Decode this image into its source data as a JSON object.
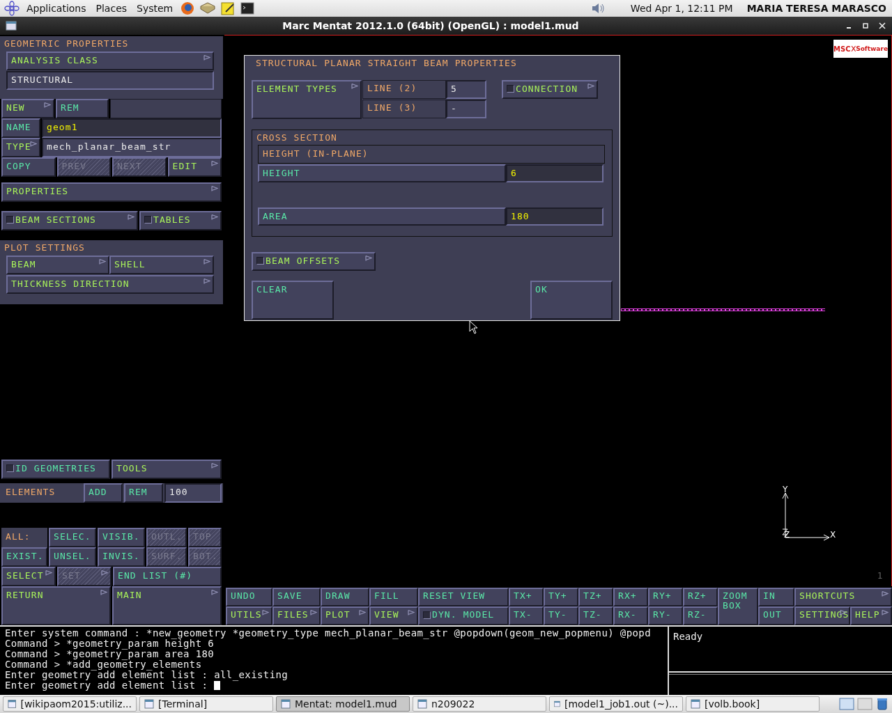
{
  "top_panel": {
    "menus": [
      "Applications",
      "Places",
      "System"
    ],
    "clock": "Wed Apr  1, 12:11 PM",
    "user": "MARIA TERESA MARASCO"
  },
  "window": {
    "title": "Marc Mentat 2012.1.0 (64bit) (OpenGL) : model1.mud"
  },
  "left_panel": {
    "title": "GEOMETRIC PROPERTIES",
    "analysis_class": {
      "kind": "menu",
      "label": "ANALYSIS CLASS"
    },
    "analysis_value": {
      "value": "STRUCTURAL",
      "editable": false
    },
    "new_rem": [
      {
        "kind": "menu",
        "label": "NEW"
      },
      {
        "kind": "action",
        "label": "REM"
      }
    ],
    "name": {
      "button": {
        "kind": "action",
        "label": "NAME"
      },
      "field": {
        "value": "geom1",
        "editable": true
      }
    },
    "type": {
      "button": {
        "kind": "menu",
        "label": "TYPE"
      },
      "field": {
        "value": "mech_planar_beam_str",
        "editable": false
      }
    },
    "nav": [
      {
        "kind": "action",
        "label": "COPY",
        "disabled": false
      },
      {
        "kind": "action",
        "label": "PREV",
        "disabled": true
      },
      {
        "kind": "action",
        "label": "NEXT",
        "disabled": true
      },
      {
        "kind": "menu",
        "label": "EDIT",
        "disabled": false
      }
    ],
    "properties": {
      "kind": "menu",
      "label": "PROPERTIES"
    },
    "sections": [
      {
        "kind": "menu",
        "label": "BEAM SECTIONS",
        "checked": false
      },
      {
        "kind": "menu",
        "label": "TABLES",
        "checked": false
      }
    ],
    "plot_settings": {
      "title": "PLOT SETTINGS",
      "buttons": [
        {
          "kind": "menu",
          "label": "BEAM"
        },
        {
          "kind": "menu",
          "label": "SHELL"
        },
        {
          "kind": "menu",
          "label": "THICKNESS DIRECTION"
        }
      ]
    },
    "geometry_tools": [
      {
        "kind": "action",
        "label": "ID GEOMETRIES",
        "checked": false
      },
      {
        "kind": "menu",
        "label": "TOOLS"
      }
    ],
    "elements": {
      "title": "ELEMENTS",
      "buttons": [
        {
          "kind": "action",
          "label": "ADD"
        },
        {
          "kind": "action",
          "label": "REM"
        }
      ],
      "field": {
        "value": "100",
        "editable": false
      }
    },
    "selection": {
      "label": "ALL:",
      "buttons": [
        {
          "kind": "action",
          "label": "SELEC.",
          "disabled": false
        },
        {
          "kind": "action",
          "label": "VISIB.",
          "disabled": false
        },
        {
          "kind": "action",
          "label": "OUTL.",
          "disabled": true
        },
        {
          "kind": "action",
          "label": "TOP",
          "disabled": true
        },
        {
          "kind": "action",
          "label": "EXIST.",
          "disabled": false
        },
        {
          "kind": "action",
          "label": "UNSEL.",
          "disabled": false
        },
        {
          "kind": "action",
          "label": "INVIS.",
          "disabled": false
        },
        {
          "kind": "action",
          "label": "SURF.",
          "disabled": true
        },
        {
          "kind": "action",
          "label": "BOT.",
          "disabled": true
        }
      ]
    },
    "select_row": [
      {
        "kind": "menu",
        "label": "SELECT",
        "disabled": false
      },
      {
        "kind": "menu",
        "label": "SET",
        "disabled": true
      },
      {
        "kind": "action",
        "label": "END LIST (#)",
        "disabled": false
      }
    ],
    "bottom": [
      {
        "kind": "menu",
        "label": "RETURN"
      },
      {
        "kind": "menu",
        "label": "MAIN"
      }
    ]
  },
  "dialog": {
    "title": "STRUCTURAL PLANAR STRAIGHT BEAM PROPERTIES",
    "element_types": {
      "kind": "menu",
      "label": "ELEMENT TYPES"
    },
    "element_rows": [
      {
        "label": "LINE (2)",
        "field": {
          "value": "5",
          "editable": false
        }
      },
      {
        "label": "LINE (3)",
        "field": {
          "value": "-",
          "editable": false
        }
      }
    ],
    "connection": {
      "kind": "menu",
      "label": "CONNECTION",
      "checked": false
    },
    "cross_section": {
      "title": "CROSS SECTION",
      "heading": "HEIGHT (IN-PLANE)",
      "params": [
        {
          "button": {
            "kind": "action",
            "label": "HEIGHT"
          },
          "field": {
            "value": "6",
            "editable": true
          }
        },
        {
          "button": {
            "kind": "action",
            "label": "AREA"
          },
          "field": {
            "value": "180",
            "editable": true
          }
        }
      ]
    },
    "beam_offsets": {
      "kind": "menu",
      "label": "BEAM OFFSETS",
      "checked": false
    },
    "clear": {
      "kind": "action",
      "label": "CLEAR"
    },
    "ok": {
      "kind": "action",
      "label": "OK"
    }
  },
  "viewport": {
    "logo": {
      "brand": "MSC",
      "name": "Software"
    },
    "axes": {
      "x": "X",
      "y": "Y",
      "z": "Z"
    },
    "page": "1"
  },
  "toolbar": {
    "columns": [
      [
        [
          {
            "kind": "action",
            "label": "UNDO"
          }
        ],
        [
          {
            "kind": "menu",
            "label": "UTILS"
          }
        ]
      ],
      [
        [
          {
            "kind": "action",
            "label": "SAVE"
          }
        ],
        [
          {
            "kind": "menu",
            "label": "FILES"
          }
        ]
      ],
      [
        [
          {
            "kind": "action",
            "label": "DRAW"
          }
        ],
        [
          {
            "kind": "menu",
            "label": "PLOT"
          }
        ]
      ],
      [
        [
          {
            "kind": "action",
            "label": "FILL"
          }
        ],
        [
          {
            "kind": "menu",
            "label": "VIEW"
          }
        ]
      ],
      [
        [
          {
            "kind": "action",
            "label": "RESET VIEW"
          }
        ],
        [
          {
            "kind": "action",
            "label": "DYN. MODEL",
            "checked": false
          }
        ]
      ],
      [
        [
          {
            "kind": "action",
            "label": "TX+"
          }
        ],
        [
          {
            "kind": "action",
            "label": "TX-"
          }
        ]
      ],
      [
        [
          {
            "kind": "action",
            "label": "TY+"
          }
        ],
        [
          {
            "kind": "action",
            "label": "TY-"
          }
        ]
      ],
      [
        [
          {
            "kind": "action",
            "label": "TZ+"
          }
        ],
        [
          {
            "kind": "action",
            "label": "TZ-"
          }
        ]
      ],
      [
        [
          {
            "kind": "action",
            "label": "RX+"
          }
        ],
        [
          {
            "kind": "action",
            "label": "RX-"
          }
        ]
      ],
      [
        [
          {
            "kind": "action",
            "label": "RY+"
          }
        ],
        [
          {
            "kind": "action",
            "label": "RY-"
          }
        ]
      ],
      [
        [
          {
            "kind": "action",
            "label": "RZ+"
          }
        ],
        [
          {
            "kind": "action",
            "label": "RZ-"
          }
        ]
      ],
      [
        [
          {
            "kind": "action",
            "label": "ZOOM BOX"
          }
        ]
      ],
      [
        [
          {
            "kind": "action",
            "label": "IN"
          }
        ],
        [
          {
            "kind": "action",
            "label": "OUT"
          }
        ]
      ],
      [
        [
          {
            "kind": "menu",
            "label": "SHORTCUTS"
          }
        ],
        [
          {
            "kind": "menu",
            "label": "SETTINGS"
          },
          {
            "kind": "menu",
            "label": "HELP"
          }
        ]
      ]
    ]
  },
  "console": {
    "lines": [
      "Enter system command : *new_geometry *geometry_type mech_planar_beam_str @popdown(geom_new_popmenu) @popd",
      "Command > *geometry_param height 6",
      "Command > *geometry_param area 180",
      "Command > *add_geometry_elements",
      "Enter geometry add element list : all_existing",
      "Enter geometry add element list : "
    ],
    "status": "Ready"
  },
  "taskbar": {
    "items": [
      {
        "label": "[wikipaom2015:utiliz...",
        "selected": false
      },
      {
        "label": "[Terminal]",
        "selected": false
      },
      {
        "label": "Mentat: model1.mud",
        "selected": true
      },
      {
        "label": "n209022",
        "selected": false
      },
      {
        "label": "[model1_job1.out (~)...",
        "selected": false
      },
      {
        "label": "[volb.book]",
        "selected": false
      }
    ]
  }
}
